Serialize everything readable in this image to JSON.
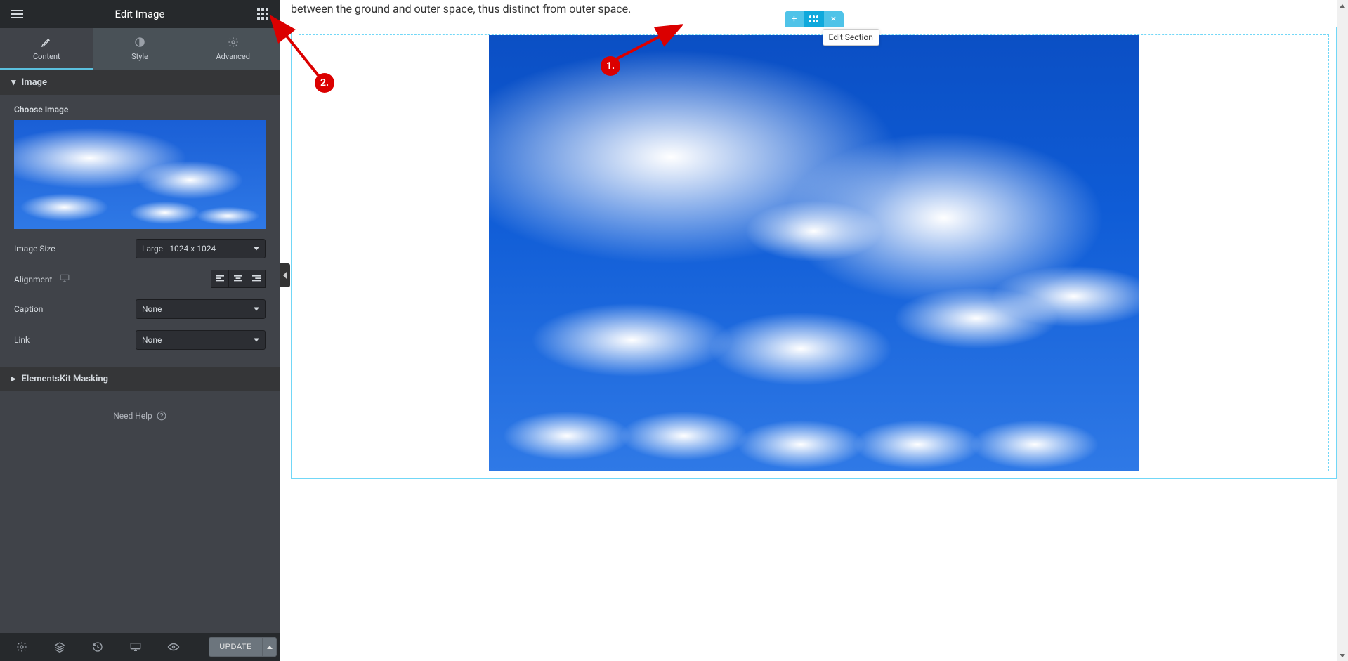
{
  "panel": {
    "title": "Edit Image",
    "tabs": {
      "content": "Content",
      "style": "Style",
      "advanced": "Advanced"
    },
    "sections": {
      "image": {
        "title": "Image",
        "choose_label": "Choose Image",
        "image_size_label": "Image Size",
        "image_size_value": "Large - 1024 x 1024",
        "alignment_label": "Alignment",
        "caption_label": "Caption",
        "caption_value": "None",
        "link_label": "Link",
        "link_value": "None"
      },
      "masking": {
        "title": "ElementsKit Masking"
      }
    },
    "help": "Need Help",
    "footer": {
      "update": "UPDATE"
    }
  },
  "canvas": {
    "top_text": "between the ground and outer space, thus distinct from outer space.",
    "tooltip": "Edit Section"
  },
  "annotations": {
    "a1": "1.",
    "a2": "2."
  }
}
